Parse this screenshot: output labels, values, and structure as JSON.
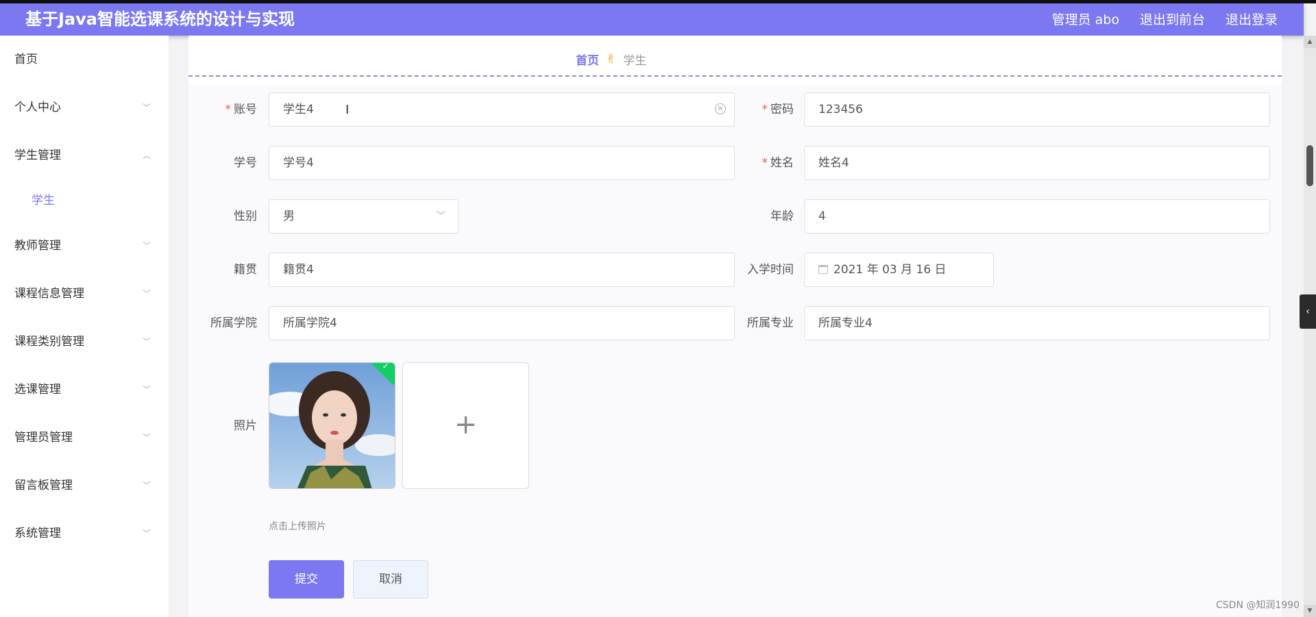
{
  "header": {
    "title": "基于Java智能选课系统的设计与实现",
    "admin": "管理员 abo",
    "back_front": "退出到前台",
    "logout": "退出登录"
  },
  "sidebar": {
    "items": [
      {
        "label": "首页"
      },
      {
        "label": "个人中心"
      },
      {
        "label": "学生管理"
      },
      {
        "label": "学生"
      },
      {
        "label": "教师管理"
      },
      {
        "label": "课程信息管理"
      },
      {
        "label": "课程类别管理"
      },
      {
        "label": "选课管理"
      },
      {
        "label": "管理员管理"
      },
      {
        "label": "留言板管理"
      },
      {
        "label": "系统管理"
      }
    ]
  },
  "breadcrumb": {
    "home": "首页",
    "current": "学生"
  },
  "form": {
    "account": {
      "label": "账号",
      "value": "学生4"
    },
    "password": {
      "label": "密码",
      "value": "123456"
    },
    "student_no": {
      "label": "学号",
      "value": "学号4"
    },
    "name": {
      "label": "姓名",
      "value": "姓名4"
    },
    "gender": {
      "label": "性别",
      "value": "男"
    },
    "age": {
      "label": "年龄",
      "value": "4"
    },
    "native_place": {
      "label": "籍贯",
      "value": "籍贯4"
    },
    "enroll_date": {
      "label": "入学时间",
      "value": "2021 年 03 月 16 日"
    },
    "college": {
      "label": "所属学院",
      "value": "所属学院4"
    },
    "major": {
      "label": "所属专业",
      "value": "所属专业4"
    },
    "photo": {
      "label": "照片",
      "tip": "点击上传照片"
    },
    "submit": "提交",
    "cancel": "取消"
  },
  "watermark": "CSDN @知润1990"
}
